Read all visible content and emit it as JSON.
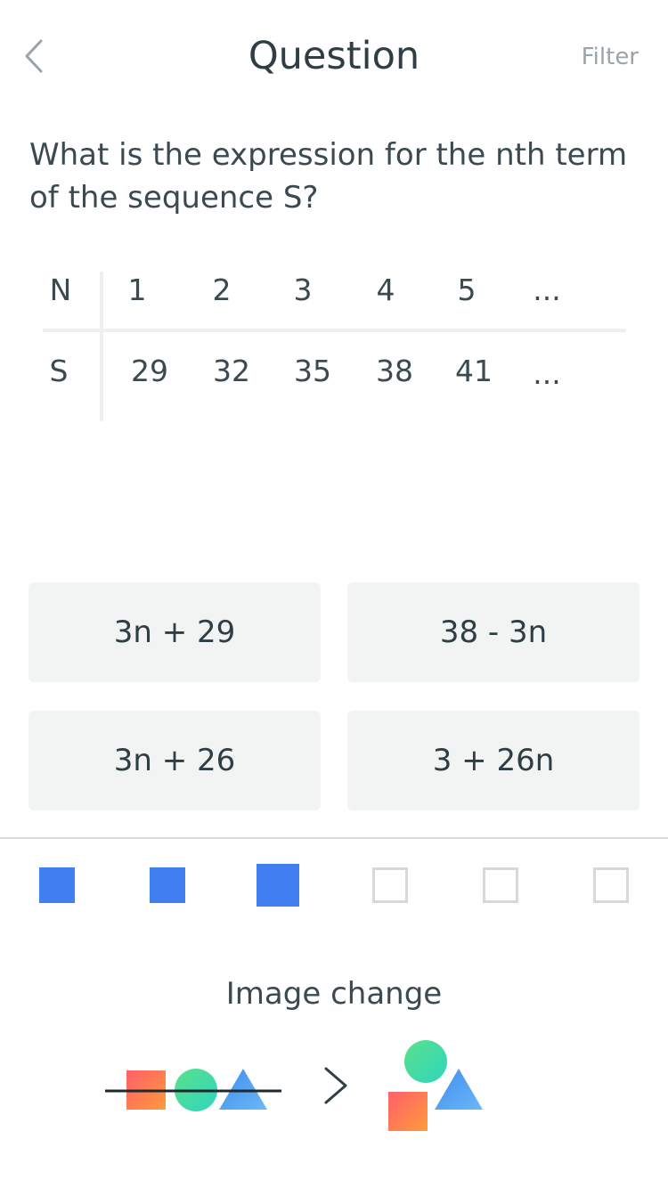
{
  "header": {
    "title": "Question",
    "filter_label": "Filter"
  },
  "question": {
    "text": "What is the expression for the nth term of the sequence S?"
  },
  "table": {
    "row_n": {
      "label": "N",
      "values": [
        "1",
        "2",
        "3",
        "4",
        "5",
        "..."
      ]
    },
    "row_s": {
      "label": "S",
      "values": [
        "29",
        "32",
        "35",
        "38",
        "41",
        "..."
      ]
    }
  },
  "answers": [
    "3n + 29",
    "38 - 3n",
    "3n + 26",
    "3 + 26n"
  ],
  "progress": {
    "completed": 3,
    "total": 6,
    "current": 3
  },
  "image_change": {
    "label": "Image change",
    "colors": {
      "square": "#fb6f53",
      "circle": "#3fdba0",
      "triangle": "#4a9df0"
    }
  },
  "colors": {
    "accent": "#3f7fef",
    "answer_bg": "#f2f3f3"
  }
}
